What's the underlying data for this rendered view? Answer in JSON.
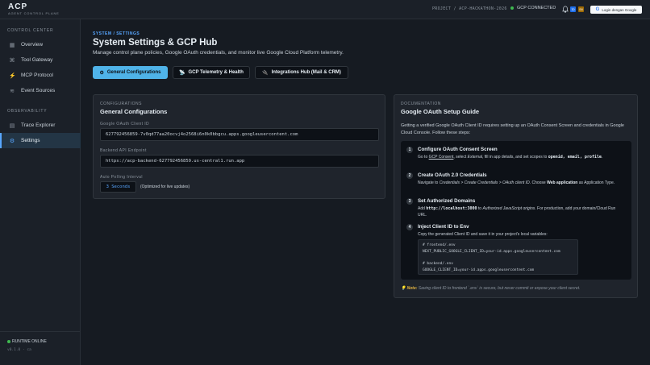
{
  "brand": {
    "title": "ACP",
    "subtitle": "AGENT CONTROL PLANE"
  },
  "topbar": {
    "project": "PROJECT / ACP-HACKATHON-2026",
    "gcp_status": "GCP CONNECTED",
    "lang_id": "ID",
    "lang_en": "EN",
    "login": "Login dengan Google",
    "icons": [
      "bell-icon",
      "google-icon"
    ]
  },
  "sidebar": {
    "section1": "CONTROL CENTER",
    "items1": [
      {
        "label": "Overview",
        "icon": "grid-icon"
      },
      {
        "label": "Tool Gateway",
        "icon": "command-icon"
      },
      {
        "label": "MCP Protocol",
        "icon": "bolt-icon"
      },
      {
        "label": "Event Sources",
        "icon": "waves-icon"
      }
    ],
    "section2": "OBSERVABILITY",
    "items2": [
      {
        "label": "Trace Explorer",
        "icon": "list-icon"
      },
      {
        "label": "Settings",
        "icon": "gear-icon",
        "active": true
      }
    ],
    "runtime": "RUNTIME ONLINE",
    "version": "v0.1.0 · ca"
  },
  "page": {
    "section": "SYSTEM / SETTINGS",
    "title": "System Settings & GCP Hub",
    "description": "Manage control plane policies, Google OAuth credentials, and monitor live Google Cloud Platform telemetry."
  },
  "tabs": [
    {
      "label": "General Configurations",
      "icon": "gear-icon",
      "active": true
    },
    {
      "label": "GCP Telemetry & Health",
      "icon": "satellite-icon"
    },
    {
      "label": "Integrations Hub (Mail & CRM)",
      "icon": "plug-icon"
    }
  ],
  "config": {
    "eyebrow": "CONFIGURATIONS",
    "title": "General Configurations",
    "client_id_label": "Google OAuth Client ID",
    "client_id": "627792456859-7v0qd77aa20ocvj4o2568i6n0k0bbgcu.apps.googleusercontent.com",
    "backend_label": "Backend API Endpoint",
    "backend": "https://acp-backend-627792456859.us-central1.run.app",
    "polling_label": "Auto Polling Interval",
    "polling_value": "3 Seconds",
    "polling_note": "(Optimized for live updates)"
  },
  "doc": {
    "eyebrow": "DOCUMENTATION",
    "title": "Google OAuth Setup Guide",
    "intro": "Getting a verified Google OAuth Client ID requires setting up an OAuth Consent Screen and credentials in Google Cloud Console. Follow these steps:",
    "steps": [
      {
        "num": "1",
        "title": "Configure OAuth Consent Screen"
      },
      {
        "num": "2",
        "title": "Create OAuth 2.0 Credentials"
      },
      {
        "num": "3",
        "title": "Set Authorized Domains"
      },
      {
        "num": "4",
        "title": "Inject Client ID to Env",
        "body": "Copy the generated Client ID and save it in your project's local variables:"
      }
    ],
    "code": "# frontend/.env\nNEXT_PUBLIC_GOOGLE_CLIENT_ID=your-id.apps.googleusercontent.com\n\n# backend/.env\nGOOGLE_CLIENT_ID=your-id.apps.googleusercontent.com",
    "note_label": "Note:",
    "note_text": "Saving client ID to frontend `.env` is secure, but never commit or expose your client secret."
  }
}
